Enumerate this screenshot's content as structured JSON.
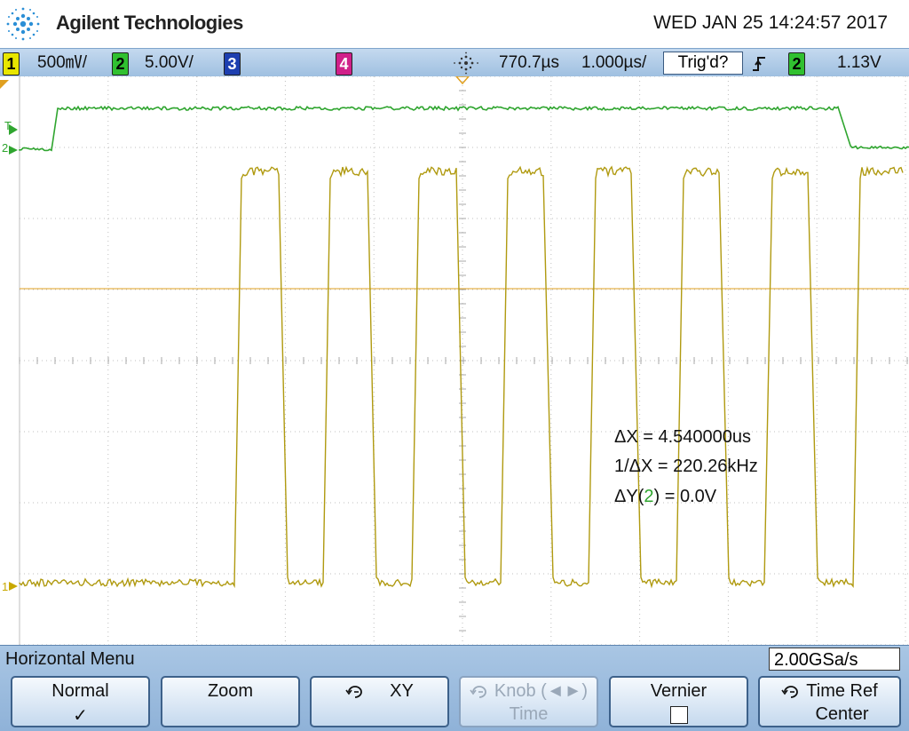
{
  "header": {
    "brand": "Agilent Technologies",
    "datetime": "WED JAN 25 14:24:57 2017"
  },
  "status_bar": {
    "ch1": {
      "number": "1",
      "scale": "500㎷/",
      "color": "#e8e600"
    },
    "ch2": {
      "number": "2",
      "scale": "5.00V/",
      "color": "#30c030"
    },
    "ch3": {
      "number": "3",
      "color": "#1d3fb0"
    },
    "ch4": {
      "number": "4",
      "color": "#d0208a"
    },
    "delay": "770.7µs",
    "timebase": "1.000µs/",
    "trigger_status": "Trig'd?",
    "trigger_slope_icon": "rising-edge-icon",
    "trigger_source": "2",
    "trigger_level": "1.13V"
  },
  "measurements": {
    "delta_x_label": "ΔX = 4.540000us",
    "inv_delta_x_label": "1/ΔX = 220.26kHz",
    "delta_y_prefix": "ΔY(",
    "delta_y_channel": "2",
    "delta_y_suffix": ") = 0.0V"
  },
  "markers": {
    "trigger_marker": "T",
    "ch2_marker": "2",
    "ch1_marker": "1"
  },
  "colors": {
    "ch1_trace": "#b09a10",
    "ch2_trace": "#2fa52f",
    "cursor_line": "#e0a020"
  },
  "menu": {
    "title": "Horizontal Menu",
    "sample_rate": "2.00GSa/s",
    "softkeys": {
      "normal": {
        "label": "Normal",
        "value": "✓"
      },
      "zoom": {
        "label": "Zoom"
      },
      "xy": {
        "label": "XY"
      },
      "knob_time": {
        "label": "Knob (◄►)",
        "value": "Time"
      },
      "vernier": {
        "label": "Vernier"
      },
      "time_ref": {
        "label": "Time Ref",
        "value": "Center"
      }
    }
  }
}
